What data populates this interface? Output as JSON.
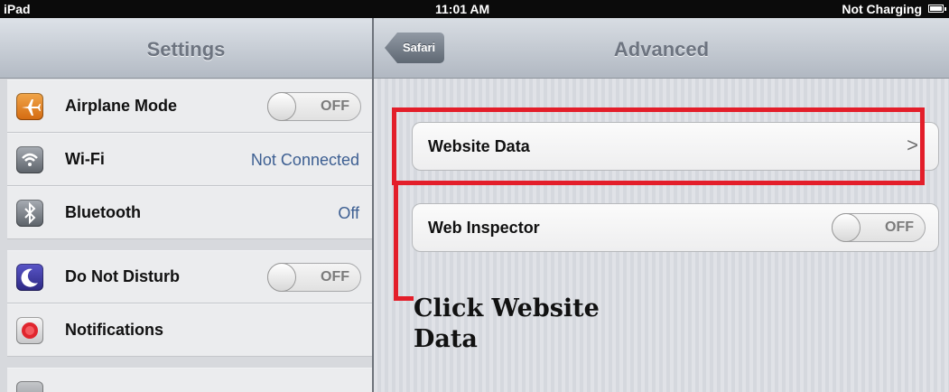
{
  "status_bar": {
    "device": "iPad",
    "time": "11:01 AM",
    "battery_status": "Not Charging",
    "battery_icon": "battery-icon"
  },
  "left_pane": {
    "title": "Settings",
    "items": [
      {
        "label": "Airplane Mode",
        "control": "toggle",
        "toggle_text": "OFF",
        "icon": "airplane-icon"
      },
      {
        "label": "Wi-Fi",
        "value": "Not Connected",
        "icon": "wifi-icon"
      },
      {
        "label": "Bluetooth",
        "value": "Off",
        "icon": "bluetooth-icon"
      },
      {
        "label": "Do Not Disturb",
        "control": "toggle",
        "toggle_text": "OFF",
        "icon": "moon-icon"
      },
      {
        "label": "Notifications",
        "icon": "notifications-icon"
      }
    ]
  },
  "right_pane": {
    "back_button": "Safari",
    "title": "Advanced",
    "website_data_label": "Website Data",
    "website_data_chevron": ">",
    "web_inspector_label": "Web Inspector",
    "web_inspector_toggle": "OFF"
  },
  "annotation": {
    "line1": "Click Website",
    "line2": "Data",
    "color": "#e31e2a"
  },
  "colors": {
    "value_blue": "#3d5f92",
    "nav_title_gray": "#6d7480"
  }
}
